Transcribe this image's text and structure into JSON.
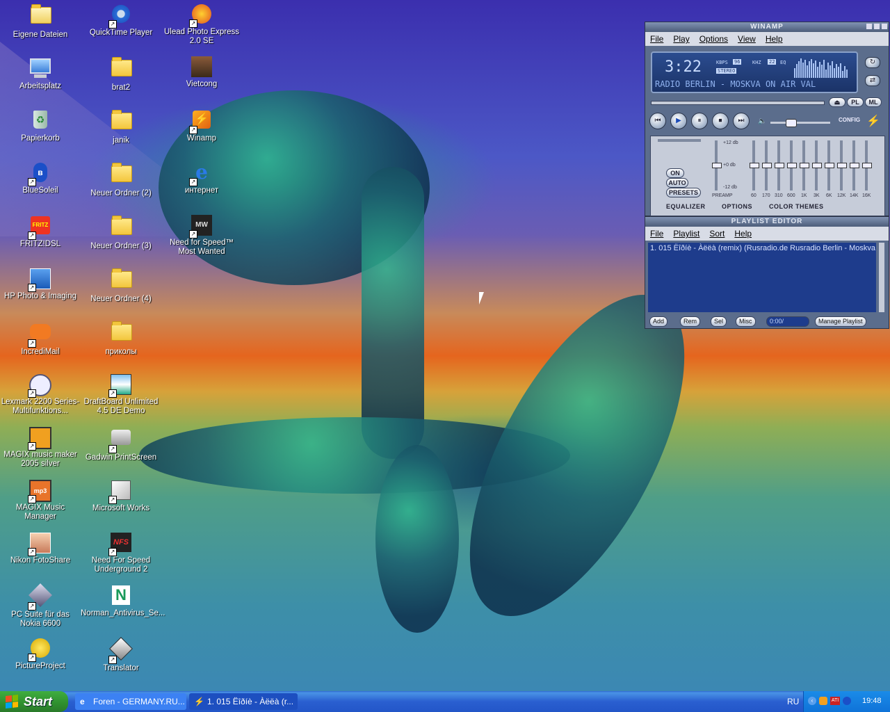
{
  "desktop_icons": [
    {
      "label": "Eigene Dateien",
      "icon": "my-documents-icon"
    },
    {
      "label": "QuickTime Player",
      "icon": "quicktime-icon"
    },
    {
      "label": "Ulead Photo Express 2.0 SE",
      "icon": "ulead-icon"
    },
    {
      "label": "Arbeitsplatz",
      "icon": "computer-icon"
    },
    {
      "label": "brat2",
      "icon": "folder-icon"
    },
    {
      "label": "Vietcong",
      "icon": "vietcong-icon"
    },
    {
      "label": "Papierkorb",
      "icon": "recycle-bin-icon"
    },
    {
      "label": "janik",
      "icon": "folder-icon"
    },
    {
      "label": "Winamp",
      "icon": "winamp-icon"
    },
    {
      "label": "BlueSoleil",
      "icon": "bluetooth-icon"
    },
    {
      "label": "Neuer Ordner (2)",
      "icon": "folder-icon"
    },
    {
      "label": "интернет",
      "icon": "internet-explorer-icon"
    },
    {
      "label": "FRITZ!DSL",
      "icon": "fritzdsl-icon"
    },
    {
      "label": "Neuer Ordner (3)",
      "icon": "folder-icon"
    },
    {
      "label": "Need for Speed™ Most Wanted",
      "icon": "nfs-most-wanted-icon"
    },
    {
      "label": "HP Photo & Imaging",
      "icon": "hp-imaging-icon"
    },
    {
      "label": "Neuer Ordner (4)",
      "icon": "folder-icon"
    },
    {
      "label": "IncrediMail",
      "icon": "incredimail-icon"
    },
    {
      "label": "приколы",
      "icon": "folder-icon"
    },
    {
      "label": "Lexmark 2200 Series-Multifunktions...",
      "icon": "lexmark-icon"
    },
    {
      "label": "DraftBoard Unlimited 4.5 DE Demo",
      "icon": "draftboard-icon"
    },
    {
      "label": "MAGIX music maker 2005 silver",
      "icon": "magix-music-maker-icon"
    },
    {
      "label": "Gadwin PrintScreen",
      "icon": "gadwin-icon"
    },
    {
      "label": "MAGIX Music Manager",
      "icon": "magix-mp3-icon"
    },
    {
      "label": "Microsoft Works",
      "icon": "ms-works-icon"
    },
    {
      "label": "Nikon FotoShare",
      "icon": "nikon-icon"
    },
    {
      "label": "Need For Speed Underground 2",
      "icon": "nfs-underground-icon"
    },
    {
      "label": "PC Suite für das Nokia 6600",
      "icon": "nokia-pc-suite-icon"
    },
    {
      "label": "Norman_Antivirus_Se...",
      "icon": "norman-antivirus-icon"
    },
    {
      "label": "PictureProject",
      "icon": "pictureproject-icon"
    },
    {
      "label": "Translator",
      "icon": "translator-icon"
    }
  ],
  "winamp": {
    "title": "WINAMP",
    "menu": [
      "File",
      "Play",
      "Options",
      "View",
      "Help"
    ],
    "time": "3:22",
    "kbps": "96",
    "khz": "22",
    "stereo": "STEREO",
    "ticker": "RADIO BERLIN - MOSKVA ON AIR VAL",
    "kbps_label": "KBPS",
    "khz_label": "KHZ",
    "eq_short": "EQ",
    "pl_btn": "PL",
    "ml_btn": "ML",
    "config": "CONFIG",
    "eq": {
      "db_top": "+12 db",
      "db_mid": "+0 db",
      "db_bot": "-12 db",
      "on": "ON",
      "auto": "AUTO",
      "presets": "PRESETS",
      "preamp": "PREAMP",
      "bands": [
        "60",
        "170",
        "310",
        "600",
        "1K",
        "3K",
        "6K",
        "12K",
        "14K",
        "16K"
      ],
      "tabs": [
        "EQUALIZER",
        "OPTIONS",
        "COLOR THEMES"
      ]
    }
  },
  "playlist": {
    "title": "PLAYLIST EDITOR",
    "menu": [
      "File",
      "Playlist",
      "Sort",
      "Help"
    ],
    "item": "1. 015 Ëîðíè - Àëëà (remix) (Rusradio.de Rusradio Berlin - Moskva...",
    "buttons": [
      "Add",
      "Rem",
      "Sel",
      "Misc"
    ],
    "time": "0:00/",
    "manage": "Manage Playlist"
  },
  "taskbar": {
    "start": "Start",
    "tasks": [
      "Foren - GERMANY.RU...",
      "1. 015 Ëîðíè - Àëëà (r..."
    ],
    "language": "RU",
    "clock": "19:48"
  }
}
